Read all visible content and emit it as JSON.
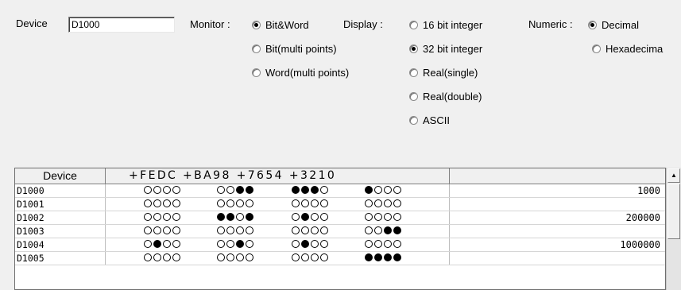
{
  "device_label": "Device",
  "device_value": "D1000",
  "monitor": {
    "label": "Monitor :",
    "options": [
      {
        "label": "Bit&Word",
        "checked": true
      },
      {
        "label": "Bit(multi points)",
        "checked": false
      },
      {
        "label": "Word(multi points)",
        "checked": false
      }
    ]
  },
  "display": {
    "label": "Display :",
    "options": [
      {
        "label": "16 bit integer",
        "checked": false
      },
      {
        "label": "32 bit integer",
        "checked": true
      },
      {
        "label": "Real(single)",
        "checked": false
      },
      {
        "label": "Real(double)",
        "checked": false
      },
      {
        "label": "ASCII",
        "checked": false
      }
    ]
  },
  "numeric": {
    "label": "Numeric :",
    "options": [
      {
        "label": "Decimal",
        "checked": true
      },
      {
        "label": "Hexadecima",
        "checked": false
      }
    ]
  },
  "table": {
    "header_device": "Device",
    "header_bits": "+FEDC +BA98 +7654 +3210",
    "header_value": "",
    "rows": [
      {
        "device": "D1000",
        "bits": "0000 0011 1110 1000",
        "value": "1000"
      },
      {
        "device": "D1001",
        "bits": "0000 0000 0000 0000",
        "value": ""
      },
      {
        "device": "D1002",
        "bits": "0000 1101 0100 0000",
        "value": "200000"
      },
      {
        "device": "D1003",
        "bits": "0000 0000 0000 0011",
        "value": ""
      },
      {
        "device": "D1004",
        "bits": "0100 0010 0100 0000",
        "value": "1000000"
      },
      {
        "device": "D1005",
        "bits": "0000 0000 0000 1111",
        "value": ""
      }
    ]
  },
  "scroll_up_icon": "triangle-up-icon"
}
